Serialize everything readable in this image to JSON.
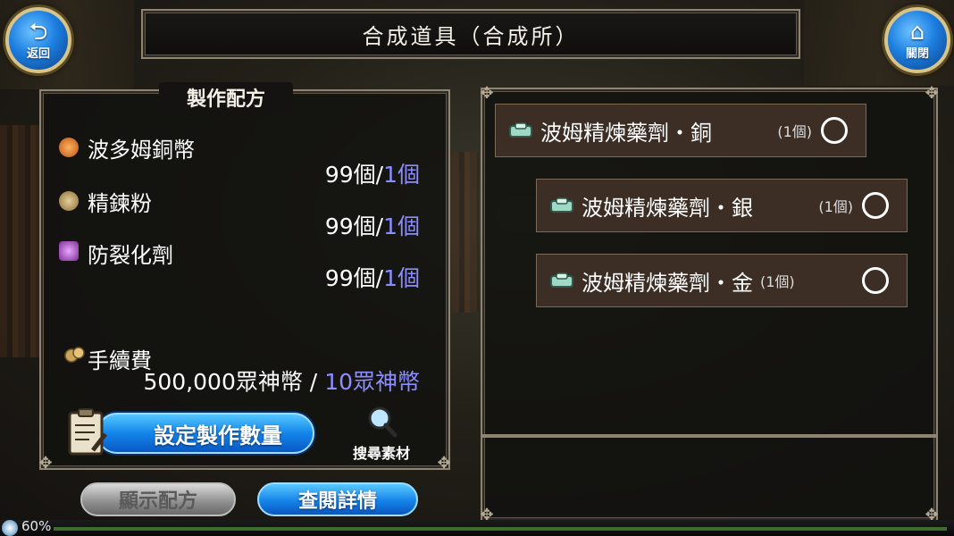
{
  "header": {
    "title": "合成道具（合成所）",
    "back_label": "返回",
    "close_label": "關閉"
  },
  "recipe": {
    "heading": "製作配方",
    "materials": [
      {
        "name": "波多姆銅幣",
        "owned": "99個",
        "sep": "/",
        "required": "1個",
        "icon": "coin-icon"
      },
      {
        "name": "精鍊粉",
        "owned": "99個",
        "sep": "/",
        "required": "1個",
        "icon": "powder-bag-icon"
      },
      {
        "name": "防裂化劑",
        "owned": "99個",
        "sep": "/",
        "required": "1個",
        "icon": "potion-flask-icon"
      }
    ],
    "fee": {
      "label": "手續費",
      "owned": "500,000眾神幣",
      "sep": " / ",
      "required": "10眾神幣"
    },
    "set_quantity_label": "設定製作數量",
    "search_material_label": "搜尋素材"
  },
  "buttons": {
    "show_recipe": "顯示配方",
    "view_details": "查閱詳情"
  },
  "items": [
    {
      "name": "波姆精煉藥劑・銅",
      "count": "(1個)",
      "selected": false
    },
    {
      "name": "波姆精煉藥劑・銀",
      "count": "(1個)",
      "selected": false
    },
    {
      "name": "波姆精煉藥劑・金",
      "count": "(1個)",
      "selected": false
    }
  ],
  "status": {
    "battery": "60%"
  },
  "colors": {
    "required_text": "#8c8dff",
    "button_blue": "#1485ea",
    "panel_border": "#8e8472"
  }
}
